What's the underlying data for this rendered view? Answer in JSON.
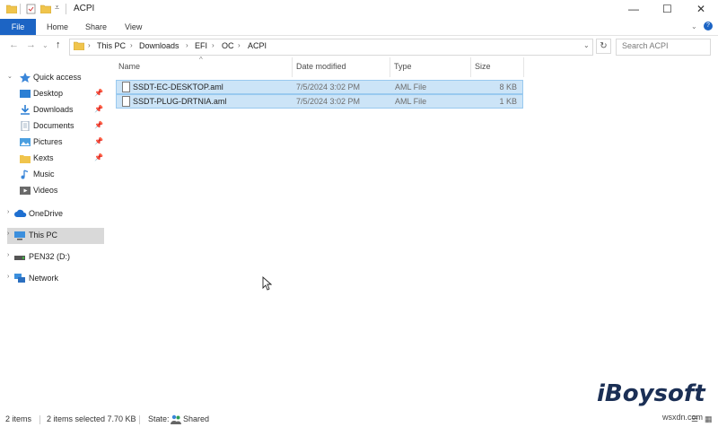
{
  "window": {
    "title": "ACPI",
    "controls": {
      "minimize": "—",
      "maximize": "☐",
      "close": "✕"
    }
  },
  "ribbon": {
    "tabs": [
      "File",
      "Home",
      "Share",
      "View"
    ]
  },
  "address_bar": {
    "breadcrumbs": [
      "This PC",
      "Downloads",
      "EFI",
      "OC",
      "ACPI"
    ],
    "search_placeholder": "Search ACPI"
  },
  "nav_pane": {
    "items": [
      {
        "label": "Quick access",
        "icon": "star-icon",
        "color": "#3a86d9",
        "pinned": false
      },
      {
        "label": "Desktop",
        "icon": "desktop-folder-icon",
        "color": "#2b7fd4",
        "pinned": true
      },
      {
        "label": "Downloads",
        "icon": "download-icon",
        "color": "#2b7fd4",
        "pinned": true
      },
      {
        "label": "Documents",
        "icon": "documents-icon",
        "color": "#8fa3b8",
        "pinned": true
      },
      {
        "label": "Pictures",
        "icon": "pictures-icon",
        "color": "#4b9fe0",
        "pinned": true
      },
      {
        "label": "Kexts",
        "icon": "folder-icon",
        "color": "#f0c44c",
        "pinned": true
      },
      {
        "label": "Music",
        "icon": "music-icon",
        "color": "#3a86d9",
        "pinned": false
      },
      {
        "label": "Videos",
        "icon": "videos-icon",
        "color": "#6a6a6a",
        "pinned": false
      },
      {
        "label": "OneDrive",
        "icon": "cloud-icon",
        "color": "#1e6fd0",
        "pinned": false
      },
      {
        "label": "This PC",
        "icon": "computer-icon",
        "color": "#3c8fdd",
        "pinned": false,
        "selected": true
      },
      {
        "label": "PEN32 (D:)",
        "icon": "usb-drive-icon",
        "color": "#555555",
        "pinned": false
      },
      {
        "label": "Network",
        "icon": "network-icon",
        "color": "#3c8fdd",
        "pinned": false
      }
    ]
  },
  "file_list": {
    "columns": [
      "Name",
      "Date modified",
      "Type",
      "Size"
    ],
    "rows": [
      {
        "name": "SSDT-EC-DESKTOP.aml",
        "date": "7/5/2024 3:02 PM",
        "type": "AML File",
        "size": "8 KB"
      },
      {
        "name": "SSDT-PLUG-DRTNIA.aml",
        "date": "7/5/2024 3:02 PM",
        "type": "AML File",
        "size": "1 KB"
      }
    ]
  },
  "status_bar": {
    "item_count": "2 items",
    "selected": "2 items selected  7.70 KB",
    "state": "State:",
    "shared": "Shared"
  },
  "watermark": {
    "brand": "iBoysoft",
    "site": "wsxdn.com"
  },
  "colors": {
    "accent": "#1c64c4",
    "selection": "#cce4f7",
    "selection_border": "#99c9ef"
  }
}
